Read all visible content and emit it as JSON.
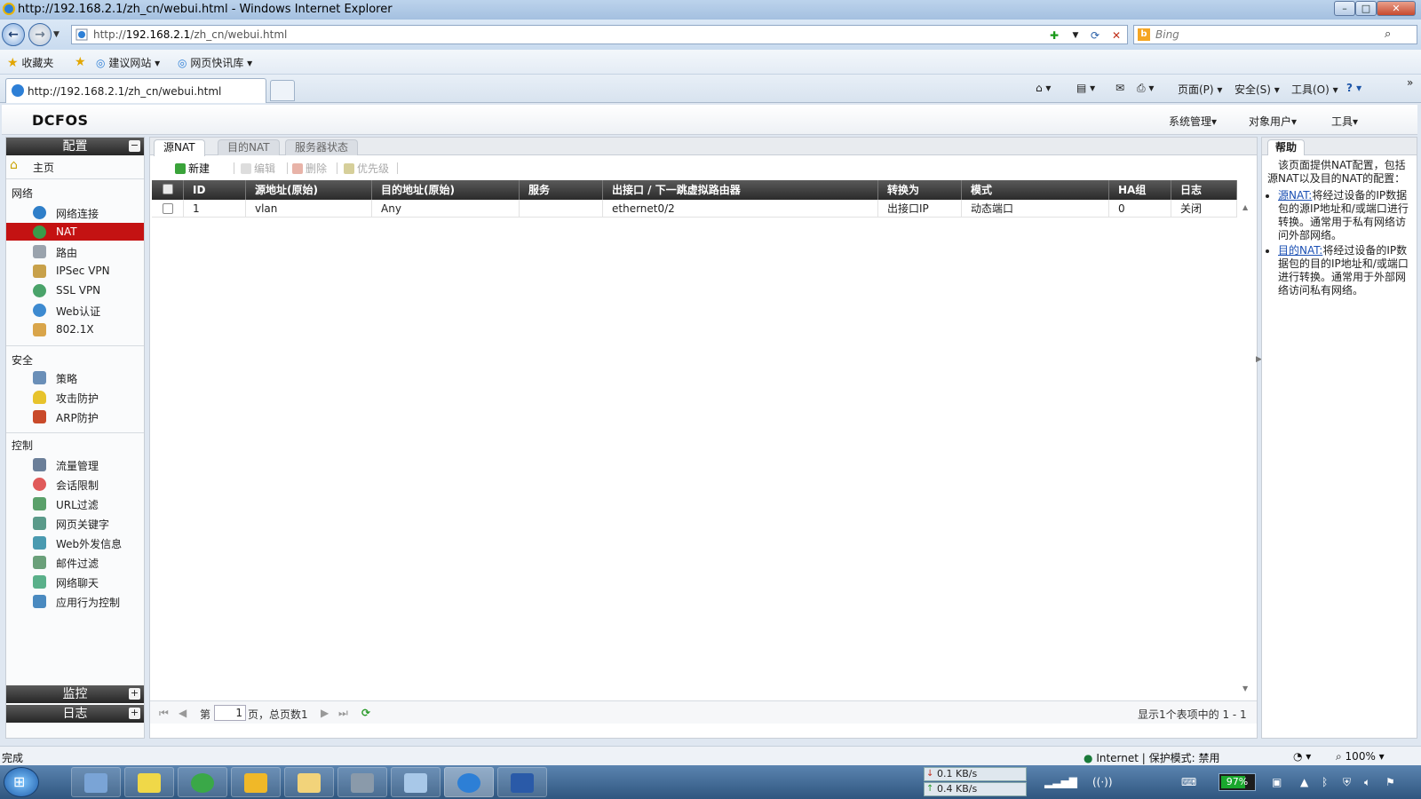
{
  "browser": {
    "window_title": "http://192.168.2.1/zh_cn/webui.html - Windows Internet Explorer",
    "address_prefix": "http://",
    "address_host": "192.168.2.1",
    "address_path": "/zh_cn/webui.html",
    "search_placeholder": "Bing",
    "favorites": [
      "收藏夹",
      "建议网站",
      "网页快讯库"
    ],
    "tab_title": "http://192.168.2.1/zh_cn/webui.html",
    "commands": [
      "页面(P)",
      "安全(S)",
      "工具(O)"
    ],
    "status_left": "完成",
    "status_zone": "Internet | 保护模式: 禁用",
    "zoom": "100%"
  },
  "app": {
    "logo": "DCFOS",
    "top_menu": [
      "系统管理",
      "对象用户",
      "工具"
    ]
  },
  "sidebar": {
    "config_title": "配置",
    "home": "主页",
    "sections": [
      {
        "title": "网络",
        "items": [
          "网络连接",
          "NAT",
          "路由",
          "IPSec VPN",
          "SSL VPN",
          "Web认证",
          "802.1X"
        ]
      },
      {
        "title": "安全",
        "items": [
          "策略",
          "攻击防护",
          "ARP防护"
        ]
      },
      {
        "title": "控制",
        "items": [
          "流量管理",
          "会话限制",
          "URL过滤",
          "网页关键字",
          "Web外发信息",
          "邮件过滤",
          "网络聊天",
          "应用行为控制"
        ]
      }
    ],
    "active_item": "NAT",
    "monitor_title": "监控",
    "log_title": "日志"
  },
  "main": {
    "tabs": [
      "源NAT",
      "目的NAT",
      "服务器状态"
    ],
    "toolbar": [
      "新建",
      "编辑",
      "删除",
      "优先级"
    ],
    "columns": [
      "ID",
      "源地址(原始)",
      "目的地址(原始)",
      "服务",
      "出接口 / 下一跳虚拟路由器",
      "转换为",
      "模式",
      "HA组",
      "日志"
    ],
    "rows": [
      [
        "1",
        "vlan",
        "Any",
        "",
        "ethernet0/2",
        "出接口IP",
        "动态端口",
        "0",
        "关闭"
      ]
    ],
    "pager": {
      "page_label_before": "第",
      "page_value": "1",
      "page_label_after": "页，总页数1",
      "summary": "显示1个表项中的 1 - 1"
    }
  },
  "help": {
    "title": "帮助",
    "intro": "该页面提供NAT配置，包括源NAT以及目的NAT的配置：",
    "items": [
      {
        "link": "源NAT:",
        "text": "将经过设备的IP数据包的源IP地址和/或端口进行转换。通常用于私有网络访问外部网络。"
      },
      {
        "link": "目的NAT:",
        "text": "将经过设备的IP数据包的目的IP地址和/或端口进行转换。通常用于外部网络访问私有网络。"
      }
    ]
  },
  "taskbar": {
    "net_down": "0.1 KB/s",
    "net_up": "0.4 KB/s",
    "battery": "97%"
  },
  "colors": {
    "active_nav": "#c41212",
    "header_dark": "#2a2a2a",
    "link": "#1a4fb3"
  }
}
